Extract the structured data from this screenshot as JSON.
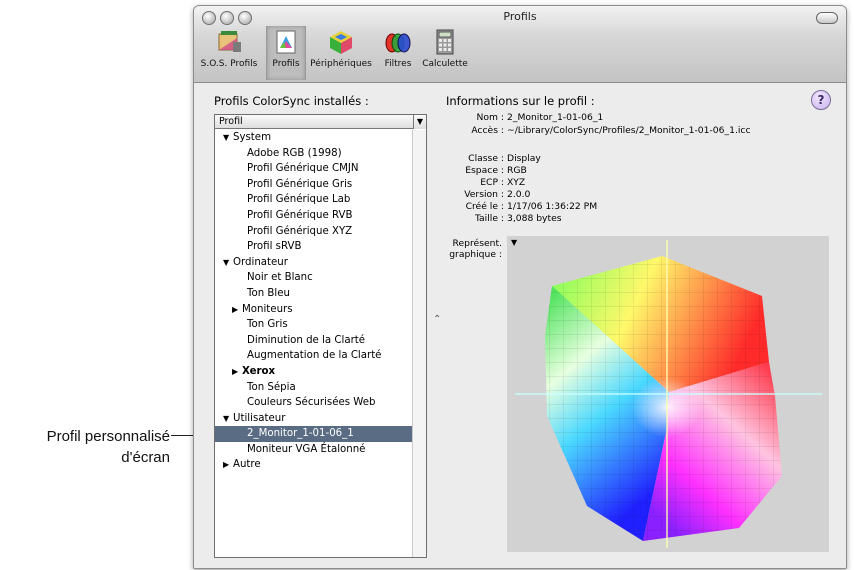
{
  "callout": {
    "line1": "Profil personnalisé",
    "line2": "d'écran"
  },
  "window": {
    "title": "Profils"
  },
  "toolbar": [
    {
      "label": "S.O.S. Profils",
      "icon": "sos-profils-icon"
    },
    {
      "label": "Profils",
      "icon": "profils-icon",
      "selected": true
    },
    {
      "label": "Périphériques",
      "icon": "peripheriques-icon"
    },
    {
      "label": "Filtres",
      "icon": "filtres-icon"
    },
    {
      "label": "Calculette",
      "icon": "calculette-icon"
    }
  ],
  "left": {
    "title": "Profils ColorSync installés :",
    "column_header": "Profil",
    "rows": [
      {
        "text": "System",
        "level": 0,
        "tri": "▼"
      },
      {
        "text": "Adobe RGB (1998)",
        "level": 1
      },
      {
        "text": "Profil Générique CMJN",
        "level": 1
      },
      {
        "text": "Profil Générique Gris",
        "level": 1
      },
      {
        "text": "Profil Générique Lab",
        "level": 1
      },
      {
        "text": "Profil Générique RVB",
        "level": 1
      },
      {
        "text": "Profil Générique XYZ",
        "level": 1
      },
      {
        "text": "Profil sRVB",
        "level": 1
      },
      {
        "text": "Ordinateur",
        "level": 0,
        "tri": "▼"
      },
      {
        "text": "Noir et Blanc",
        "level": 1
      },
      {
        "text": "Ton Bleu",
        "level": 1
      },
      {
        "text": "Moniteurs",
        "level": 1,
        "tri": "▶"
      },
      {
        "text": "Ton Gris",
        "level": 1
      },
      {
        "text": "Diminution de la Clarté",
        "level": 1
      },
      {
        "text": "Augmentation de la Clarté",
        "level": 1
      },
      {
        "text": "Xerox",
        "level": 1,
        "tri": "▶"
      },
      {
        "text": "Ton Sépia",
        "level": 1
      },
      {
        "text": "Couleurs Sécurisées Web",
        "level": 1
      },
      {
        "text": "Utilisateur",
        "level": 0,
        "tri": "▼"
      },
      {
        "text": "2_Monitor_1-01-06_1",
        "level": 1,
        "selected": true
      },
      {
        "text": "Moniteur VGA Étalonné",
        "level": 1
      },
      {
        "text": "Autre",
        "level": 0,
        "tri": "▶"
      }
    ]
  },
  "right": {
    "title": "Informations sur le profil :",
    "help": "?",
    "info1": [
      {
        "key": "Nom :",
        "value": "2_Monitor_1-01-06_1"
      },
      {
        "key": "Accès :",
        "value": "~/Library/ColorSync/Profiles/2_Monitor_1-01-06_1.icc"
      }
    ],
    "info2": [
      {
        "key": "Classe :",
        "value": "Display"
      },
      {
        "key": "Espace :",
        "value": "RGB"
      },
      {
        "key": "ECP :",
        "value": "XYZ"
      },
      {
        "key": "Version :",
        "value": "2.0.0"
      },
      {
        "key": "Créé le :",
        "value": "1/17/06 1:36:22 PM"
      },
      {
        "key": "Taille :",
        "value": "3,088 bytes"
      }
    ],
    "graph_label": "Représent. graphique :",
    "graph_menu": "▼"
  }
}
